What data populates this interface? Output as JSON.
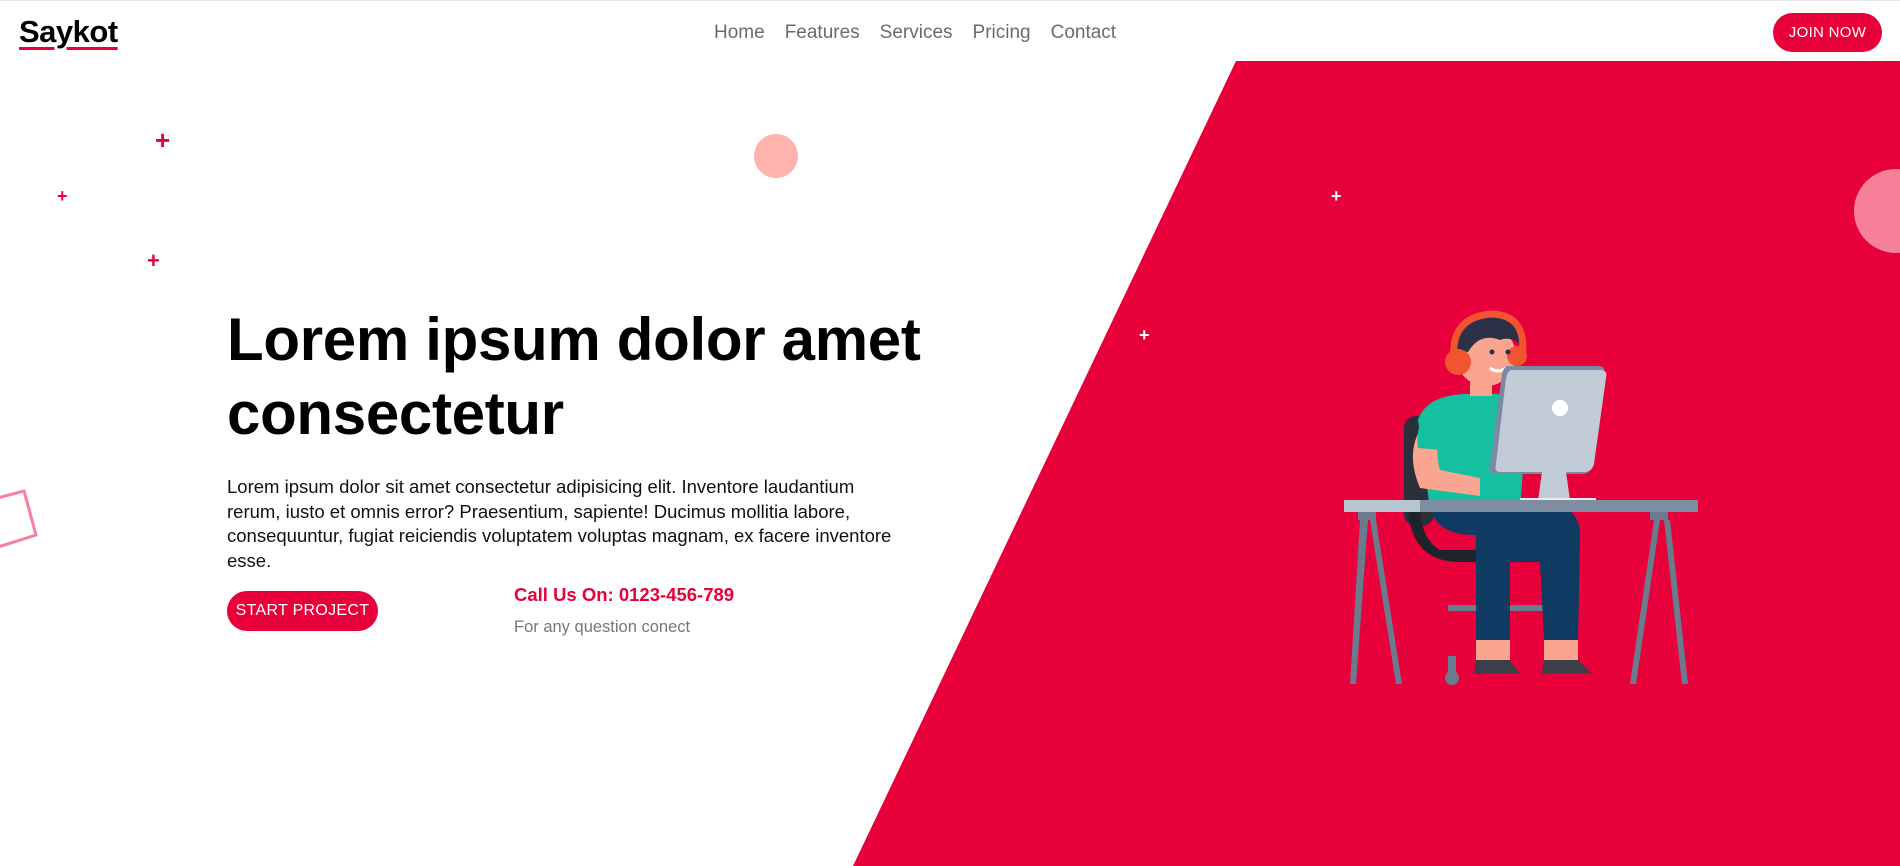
{
  "brand": {
    "logo": "Saykot"
  },
  "nav": {
    "links": [
      {
        "label": "Home"
      },
      {
        "label": "Features"
      },
      {
        "label": "Services"
      },
      {
        "label": "Pricing"
      },
      {
        "label": "Contact"
      }
    ],
    "cta_label": "JOIN NOW"
  },
  "hero": {
    "title_line1": "Lorem ipsum dolor amet",
    "title_line2": "consectetur",
    "text": "Lorem ipsum dolor sit amet consectetur adipisicing elit. Inventore laudantium rerum, iusto et omnis error? Praesentium, sapiente! Ducimus mollitia labore, consequuntur, fugiat reiciendis voluptatem voluptas magnam, ex facere inventore esse.",
    "start_label": "START PROJECT",
    "call_label": "Call Us On: 0123-456-789",
    "call_sub": "For any question conect"
  },
  "colors": {
    "accent": "#e8003a",
    "peach": "#ffb3ad",
    "pink": "#f7819b",
    "nav_text": "#6b6b6b"
  },
  "icons": [
    "plus-icon",
    "circle-decoration",
    "square-outline-decoration",
    "developer-illustration"
  ]
}
